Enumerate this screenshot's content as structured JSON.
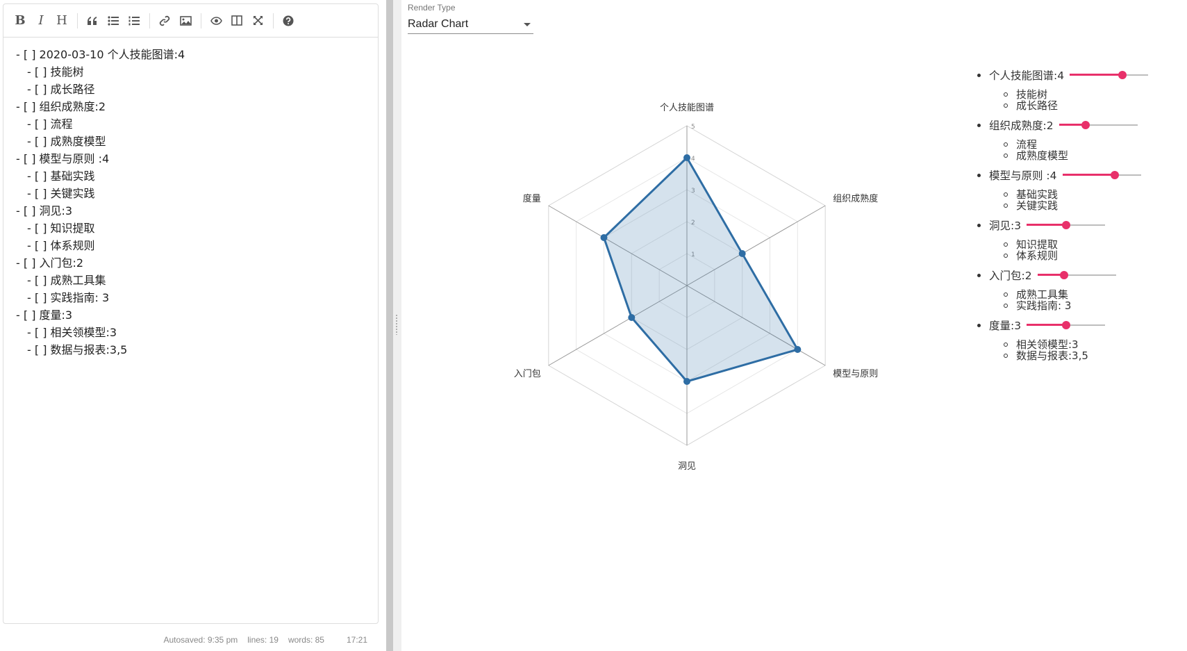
{
  "toolbar": {
    "bold": "B",
    "italic": "I",
    "heading": "H"
  },
  "editor": {
    "lines": [
      {
        "text": "- [ ] 2020-03-10 个人技能图谱:4",
        "sub": false
      },
      {
        "text": "- [ ] 技能树",
        "sub": true
      },
      {
        "text": "- [ ] 成长路径",
        "sub": true
      },
      {
        "text": "- [ ] 组织成熟度:2",
        "sub": false
      },
      {
        "text": "- [ ] 流程",
        "sub": true
      },
      {
        "text": "- [ ] 成熟度模型",
        "sub": true
      },
      {
        "text": "- [ ] 模型与原则 :4",
        "sub": false
      },
      {
        "text": "- [ ] 基础实践",
        "sub": true
      },
      {
        "text": "- [ ] 关键实践",
        "sub": true
      },
      {
        "text": "- [ ] 洞见:3",
        "sub": false
      },
      {
        "text": "- [ ] 知识提取",
        "sub": true
      },
      {
        "text": "- [ ] 体系规则",
        "sub": true
      },
      {
        "text": "- [ ] 入门包:2",
        "sub": false
      },
      {
        "text": "- [ ] 成熟工具集",
        "sub": true
      },
      {
        "text": "- [ ] 实践指南: 3",
        "sub": true
      },
      {
        "text": "- [ ] 度量:3",
        "sub": false
      },
      {
        "text": "- [ ] 相关领模型:3",
        "sub": true
      },
      {
        "text": "- [ ] 数据与报表:3,5",
        "sub": true
      }
    ]
  },
  "status": {
    "autosaved": "Autosaved: 9:35 pm",
    "lines": "lines: 19",
    "words": "words: 85",
    "cursor": "17:21"
  },
  "render_type": {
    "label": "Render Type",
    "value": "Radar Chart"
  },
  "chart_data": {
    "type": "radar",
    "categories": [
      "个人技能图谱",
      "组织成熟度",
      "模型与原则",
      "洞见",
      "入门包",
      "度量"
    ],
    "values": [
      4,
      2,
      4,
      3,
      2,
      3
    ],
    "rlim": [
      0,
      5
    ],
    "ticks": [
      "1",
      "2",
      "3",
      "4",
      "5"
    ],
    "color": "#2e6da4",
    "fill": "rgba(46,109,164,0.2)"
  },
  "skills": [
    {
      "label": "个人技能图谱:4",
      "value": 4,
      "max": 5,
      "subs": [
        "技能树",
        "成长路径"
      ]
    },
    {
      "label": "组织成熟度:2",
      "value": 2,
      "max": 5,
      "subs": [
        "流程",
        "成熟度模型"
      ]
    },
    {
      "label": "模型与原则 :4",
      "value": 4,
      "max": 5,
      "subs": [
        "基础实践",
        "关键实践"
      ]
    },
    {
      "label": "洞见:3",
      "value": 3,
      "max": 5,
      "subs": [
        "知识提取",
        "体系规则"
      ]
    },
    {
      "label": "入门包:2",
      "value": 2,
      "max": 5,
      "subs": [
        "成熟工具集",
        "实践指南: 3"
      ]
    },
    {
      "label": "度量:3",
      "value": 3,
      "max": 5,
      "subs": [
        "相关领模型:3",
        "数据与报表:3,5"
      ]
    }
  ],
  "accent": "#e8306a"
}
